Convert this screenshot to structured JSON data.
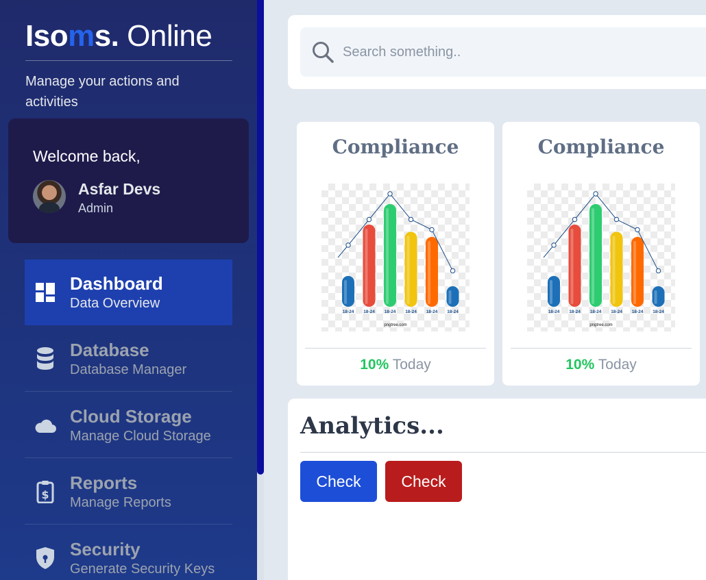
{
  "brand": {
    "part1": "Iso",
    "part2": "m",
    "part3": "s.",
    "part4": " Online"
  },
  "tagline": "Manage your actions and activities",
  "welcome": {
    "greeting": "Welcome back,",
    "name": "Asfar Devs",
    "role": "Admin"
  },
  "nav": [
    {
      "title": "Dashboard",
      "sub": "Data Overview",
      "icon": "dashboard-icon",
      "active": true
    },
    {
      "title": "Database",
      "sub": "Database Manager",
      "icon": "database-icon",
      "active": false
    },
    {
      "title": "Cloud Storage",
      "sub": "Manage Cloud Storage",
      "icon": "cloud-icon",
      "active": false
    },
    {
      "title": "Reports",
      "sub": "Manage Reports",
      "icon": "report-icon",
      "active": false
    },
    {
      "title": "Security",
      "sub": "Generate Security Keys",
      "icon": "shield-icon",
      "active": false
    }
  ],
  "search": {
    "placeholder": "Search something.."
  },
  "cards": [
    {
      "title": "Compliance",
      "percent": "10%",
      "label": " Today"
    },
    {
      "title": "Compliance",
      "percent": "10%",
      "label": " Today"
    }
  ],
  "chart_image": {
    "bar_labels": [
      "18-24",
      "18-24",
      "18-24",
      "18-24",
      "18-24",
      "18-24"
    ],
    "bar_values": [
      3,
      8,
      10,
      7.3,
      6.8,
      2
    ],
    "line_values": [
      6,
      8.5,
      11,
      8.5,
      7.5,
      3.5
    ],
    "bar_colors": [
      "#1d70b8",
      "#e74c3c",
      "#2ecc71",
      "#f1c40f",
      "#ff6a00",
      "#1d70b8"
    ],
    "watermark": "pngtree.com"
  },
  "analytics": {
    "title": "Analytics...",
    "btn1": "Check",
    "btn2": "Check"
  },
  "colors": {
    "accent": "#2563eb",
    "active_nav": "#1e40af",
    "success": "#22c55e",
    "danger": "#b91c1c"
  }
}
